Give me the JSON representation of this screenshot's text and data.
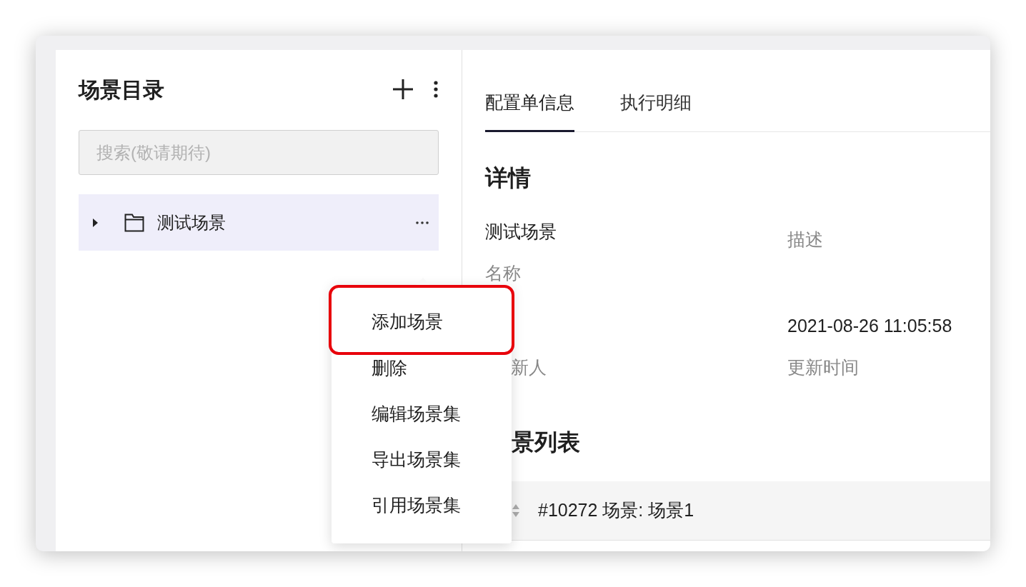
{
  "sidebar": {
    "title": "场景目录",
    "search": {
      "placeholder": "搜索(敬请期待)"
    },
    "tree": [
      {
        "label": "测试场景",
        "expanded": false,
        "selected": true
      }
    ]
  },
  "context_menu": {
    "items": [
      {
        "label": "添加场景",
        "highlighted": true
      },
      {
        "label": "删除",
        "highlighted": false
      },
      {
        "label": "编辑场景集",
        "highlighted": false
      },
      {
        "label": "导出场景集",
        "highlighted": false
      },
      {
        "label": "引用场景集",
        "highlighted": false
      }
    ]
  },
  "tabs": [
    {
      "label": "配置单信息",
      "selected": true
    },
    {
      "label": "执行明细",
      "selected": false
    }
  ],
  "details": {
    "title": "详情",
    "fields": [
      {
        "kind": "full",
        "value": "测试场景",
        "label": "名称"
      },
      {
        "kind": "full",
        "label": "描述"
      },
      {
        "kind": "clipped",
        "label": "新人"
      },
      {
        "kind": "full",
        "value": "2021-08-26 11:05:58",
        "label": "更新时间"
      }
    ]
  },
  "scene_list": {
    "title": "景列表",
    "rows": [
      {
        "label": "#10272 场景: 场景1"
      }
    ]
  }
}
